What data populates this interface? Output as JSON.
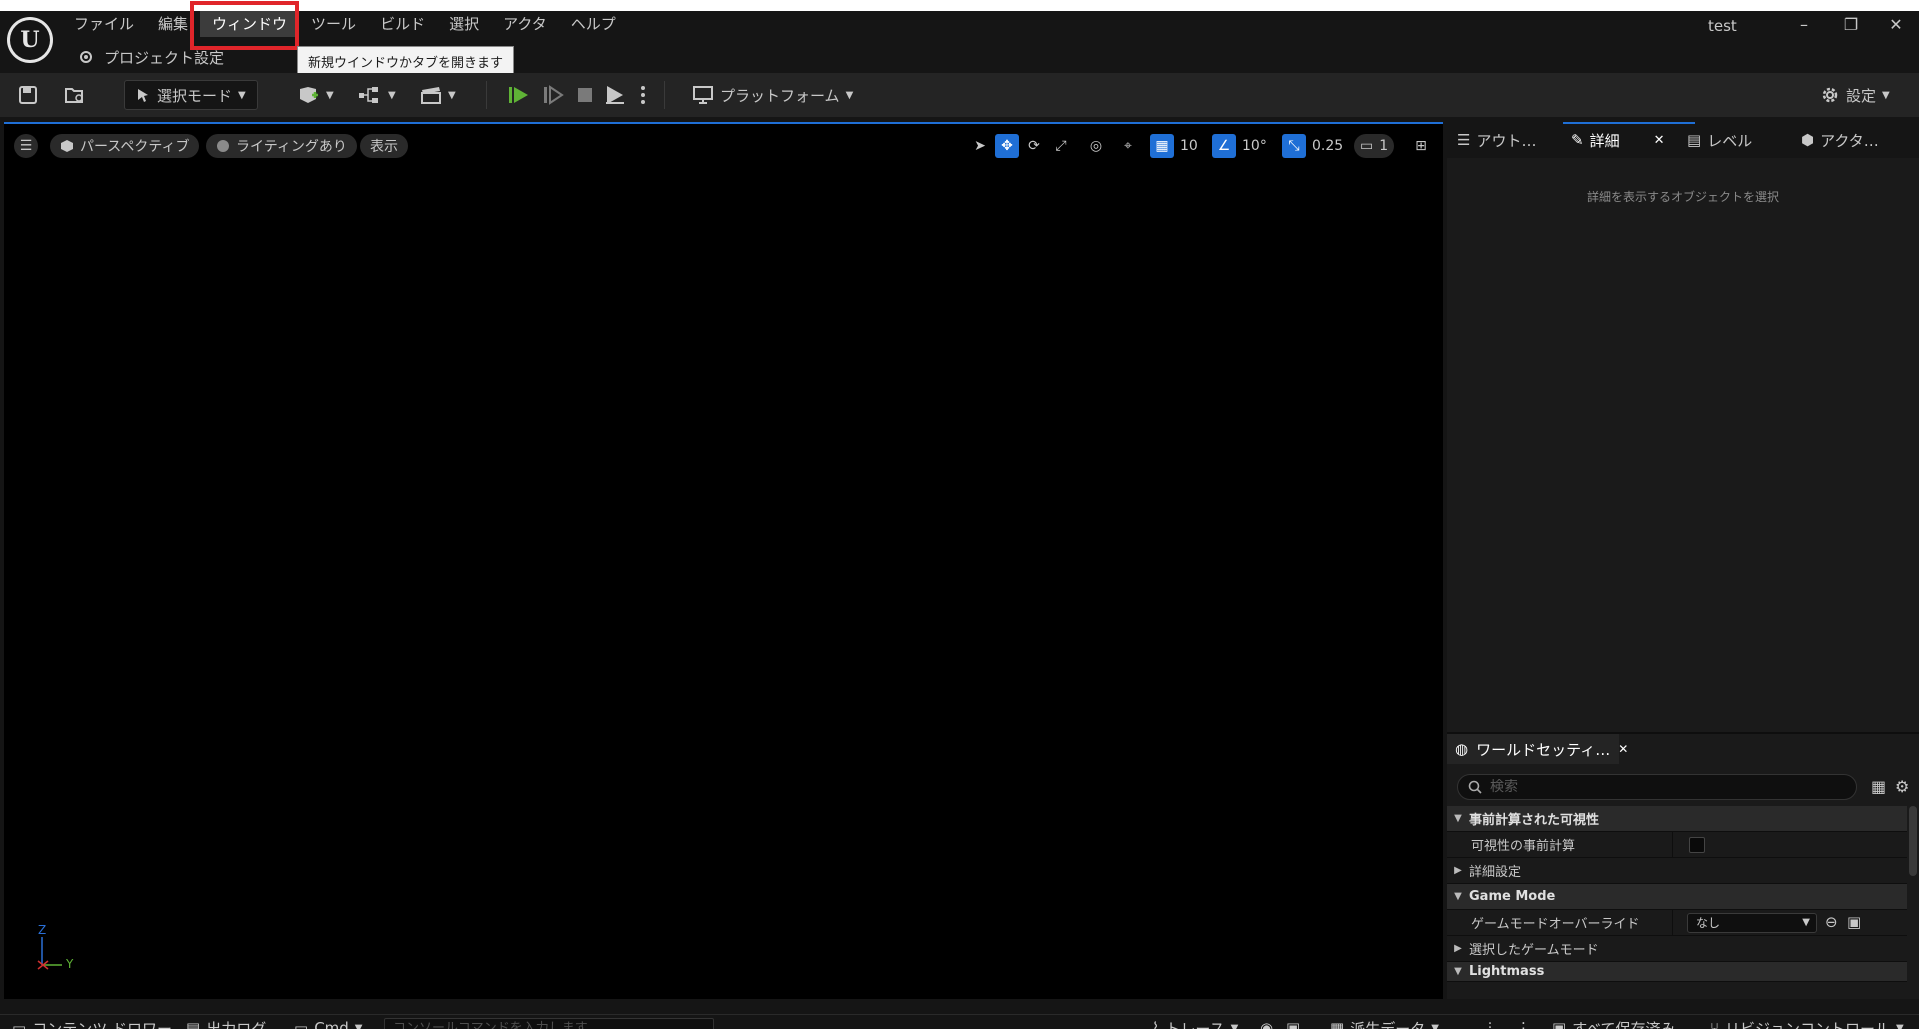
{
  "menu": {
    "items": [
      "ファイル",
      "編集",
      "ウィンドウ",
      "ツール",
      "ビルド",
      "選択",
      "アクタ",
      "ヘルプ"
    ],
    "active_index": 2,
    "project_tab": "プロジェクト設定",
    "tooltip": "新規ウインドウかタブを開きます"
  },
  "window": {
    "project_name": "test",
    "minimize": "–",
    "restore": "❐",
    "close": "✕"
  },
  "toolbar": {
    "select_mode": "選択モード",
    "platform": "プラットフォーム",
    "settings": "設定"
  },
  "viewport": {
    "perspective": "パースペクティブ",
    "lighting": "ライティングあり",
    "show": "表示",
    "grid_snap": "10",
    "rotation_snap": "10°",
    "scale_snap": "0.25",
    "camera_speed": "1",
    "axis_z": "Z",
    "axis_y": "Y"
  },
  "right_panel": {
    "tabs": [
      "アウト…",
      "詳細",
      "レベル",
      "アクタ…"
    ],
    "active_tab": 1,
    "details_empty": "詳細を表示するオブジェクトを選択",
    "world_settings_tab": "ワールドセッティ…",
    "search_placeholder": "検索",
    "rows": {
      "precomputed_visibility": "事前計算された可視性",
      "precompute_visibility": "可視性の事前計算",
      "advanced": "詳細設定",
      "game_mode": "Game Mode",
      "gamemode_override": "ゲームモードオーバーライド",
      "gamemode_override_value": "なし",
      "selected_gamemode": "選択したゲームモード",
      "lightmass": "Lightmass"
    }
  },
  "bottombar": {
    "content_drawer": "コンテンツ ドロワー",
    "output_log": "出力ログ",
    "cmd": "Cmd",
    "console_placeholder": "コンソールコマンドを入力します",
    "trace": "トレース",
    "derived_data": "派生データ",
    "all_saved": "すべて保存済み",
    "revision_control": "リビジョンコントロール"
  },
  "colors": {
    "accent": "#1f6fd6",
    "highlight_box": "#e0252a",
    "play_green": "#5fb336"
  }
}
